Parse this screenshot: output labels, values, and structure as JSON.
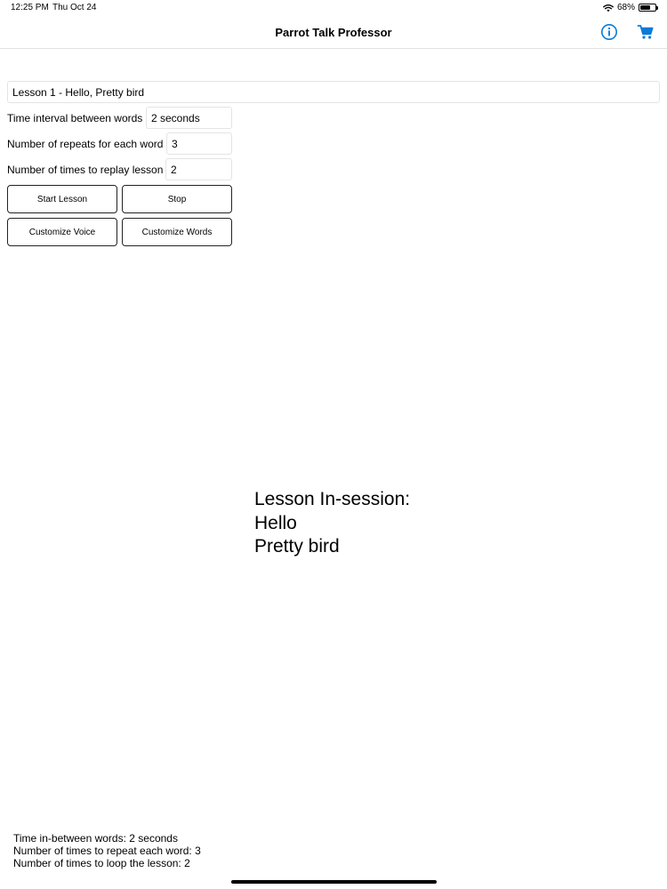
{
  "status_bar": {
    "time": "12:25 PM",
    "date": "Thu Oct 24",
    "battery_percent": "68%",
    "battery_level": 0.68,
    "wifi_icon": "wifi-icon",
    "battery_icon": "battery-icon"
  },
  "nav": {
    "title": "Parrot Talk Professor",
    "info_icon": "info-icon",
    "cart_icon": "cart-icon",
    "accent_color": "#0a7bd8"
  },
  "lesson": {
    "selected": "Lesson 1 - Hello, Pretty bird"
  },
  "settings": {
    "interval_label": "Time interval between words",
    "interval_value": "2 seconds",
    "repeats_label": "Number of repeats for each word",
    "repeats_value": "3",
    "replay_label": "Number of times to replay lesson",
    "replay_value": "2"
  },
  "buttons": {
    "start": "Start Lesson",
    "stop": "Stop",
    "customize_voice": "Customize Voice",
    "customize_words": "Customize Words"
  },
  "session": {
    "heading": "Lesson In-session:",
    "words": [
      "Hello",
      "Pretty bird"
    ]
  },
  "summary": {
    "line1": "Time in-between words: 2 seconds",
    "line2": "Number of times to repeat each word: 3",
    "line3": "Number of times to loop the lesson: 2"
  }
}
